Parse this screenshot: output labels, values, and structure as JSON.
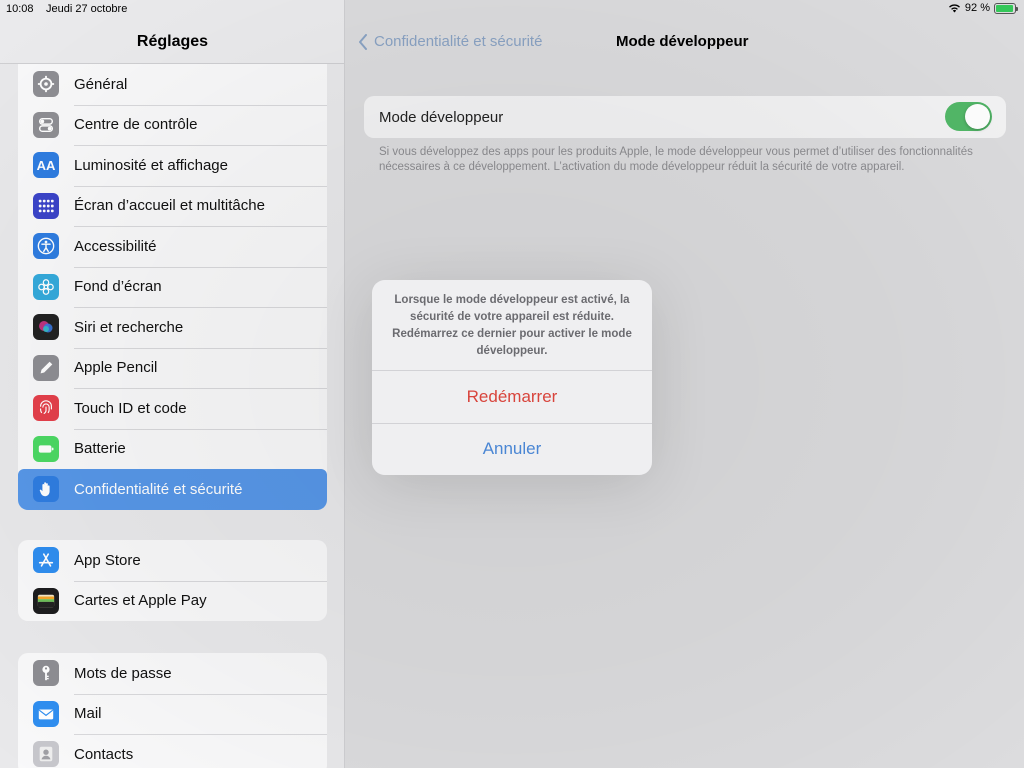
{
  "status_bar": {
    "time": "10:08",
    "date": "Jeudi 27 octobre",
    "battery_text": "92 %",
    "battery_level": 0.92,
    "wifi_icon": "wifi-icon"
  },
  "sidebar": {
    "title": "Réglages",
    "groups": [
      {
        "items": [
          {
            "label": "Général",
            "icon": "gear-icon",
            "color": "#8e8e93"
          },
          {
            "label": "Centre de contrôle",
            "icon": "toggles-icon",
            "color": "#8e8e93"
          },
          {
            "label": "Luminosité et affichage",
            "icon": "text-size-icon",
            "color": "#2f7de1",
            "glyph": "AA"
          },
          {
            "label": "Écran d’accueil et multitâche",
            "icon": "app-grid-icon",
            "color": "#3b44c9"
          },
          {
            "label": "Accessibilité",
            "icon": "accessibility-icon",
            "color": "#2f7de1"
          },
          {
            "label": "Fond d’écran",
            "icon": "flower-icon",
            "color": "#34aadc"
          },
          {
            "label": "Siri et recherche",
            "icon": "siri-icon",
            "color": "#222222"
          },
          {
            "label": "Apple Pencil",
            "icon": "pencil-icon",
            "color": "#8e8e93"
          },
          {
            "label": "Touch ID et code",
            "icon": "fingerprint-icon",
            "color": "#e5404b"
          },
          {
            "label": "Batterie",
            "icon": "battery-icon",
            "color": "#4cd964"
          },
          {
            "label": "Confidentialité et sécurité",
            "icon": "hand-icon",
            "color": "#2f7de1",
            "selected": true
          }
        ]
      },
      {
        "items": [
          {
            "label": "App Store",
            "icon": "app-store-icon",
            "color": "#2f8ef0"
          },
          {
            "label": "Cartes et Apple Pay",
            "icon": "wallet-icon",
            "color": "#1c1c1e"
          }
        ]
      },
      {
        "items": [
          {
            "label": "Mots de passe",
            "icon": "key-icon",
            "color": "#8e8e93"
          },
          {
            "label": "Mail",
            "icon": "mail-icon",
            "color": "#2f8ef0"
          },
          {
            "label": "Contacts",
            "icon": "contacts-icon",
            "color": "#c7c7cc"
          }
        ]
      }
    ]
  },
  "main": {
    "back_label": "Confidentialité et sécurité",
    "title": "Mode développeur",
    "setting": {
      "label": "Mode développeur",
      "enabled": true,
      "toggle_color": "#52b868"
    },
    "footnote": "Si vous développez des apps pour les produits Apple, le mode développeur vous permet d’utiliser des fonctionnalités nécessaires à ce développement. L’activation du mode développeur réduit la sécurité de votre appareil."
  },
  "alert": {
    "message": "Lorsque le mode développeur est activé, la sécurité de votre appareil est réduite. Redémarrez ce dernier pour activer le mode développeur.",
    "confirm_label": "Redémarrer",
    "cancel_label": "Annuler",
    "confirm_color": "#d8443c",
    "cancel_color": "#4a86d4"
  }
}
